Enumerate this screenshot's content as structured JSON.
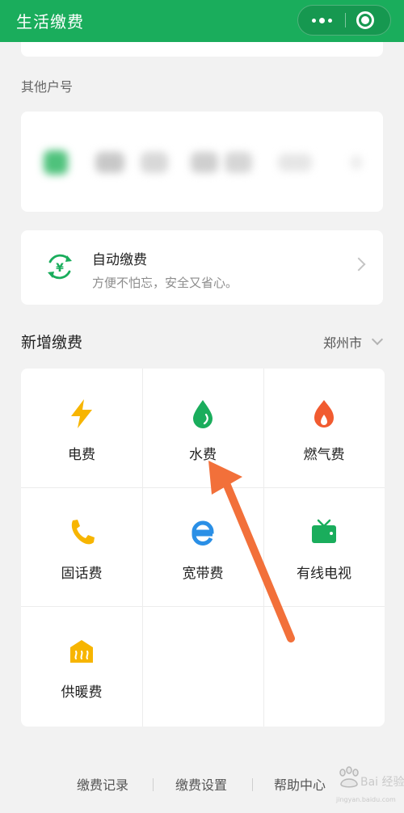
{
  "header": {
    "title": "生活缴费",
    "more_icon": "more-dots-icon",
    "close_icon": "target-close-icon",
    "color": "#1aad5c"
  },
  "other_accounts": {
    "label": "其他户号"
  },
  "auto_pay": {
    "title": "自动缴费",
    "subtitle": "方便不怕忘，安全又省心。",
    "icon": "yuan-cycle-icon"
  },
  "new_payment": {
    "title": "新增缴费",
    "city": "郑州市",
    "items": [
      {
        "label": "电费",
        "icon": "lightning-icon",
        "color": "#f7b500"
      },
      {
        "label": "水费",
        "icon": "water-drop-icon",
        "color": "#1aad5c"
      },
      {
        "label": "燃气费",
        "icon": "flame-icon",
        "color": "#f15b30"
      },
      {
        "label": "固话费",
        "icon": "phone-icon",
        "color": "#f7b500"
      },
      {
        "label": "宽带费",
        "icon": "broadband-e-icon",
        "color": "#2a8fe6"
      },
      {
        "label": "有线电视",
        "icon": "tv-icon",
        "color": "#1aad5c"
      },
      {
        "label": "供暖费",
        "icon": "heating-icon",
        "color": "#f7b500"
      }
    ]
  },
  "footer": {
    "links": [
      "缴费记录",
      "缴费设置",
      "帮助中心"
    ]
  },
  "watermark": {
    "text": "Bai 经验",
    "sub": "jingyan.baidu.com"
  }
}
